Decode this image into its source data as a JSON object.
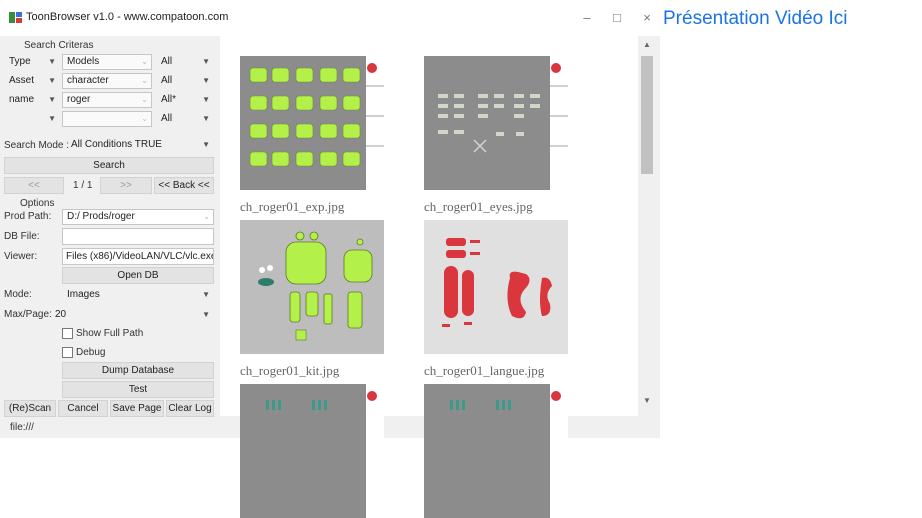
{
  "window": {
    "title": "ToonBrowser v1.0 - www.compatoon.com",
    "minimize": "–",
    "maximize": "□",
    "close": "×"
  },
  "link": {
    "text": "Présentation Vidéo Ici"
  },
  "search": {
    "header": "Search Criteras",
    "rows": [
      {
        "field": "Type",
        "op": "Models",
        "cond": "All"
      },
      {
        "field": "Asset",
        "op": "character",
        "cond": "All"
      },
      {
        "field": "name",
        "op": "roger",
        "cond": "All*"
      },
      {
        "field": "",
        "op": "",
        "cond": "All"
      }
    ],
    "mode_label": "Search Mode :",
    "mode_value": "All Conditions TRUE",
    "search_button": "Search",
    "prev_button": "<<",
    "page": "1 / 1",
    "next_button": ">>",
    "back_button": "<< Back <<"
  },
  "options": {
    "header": "Options",
    "prod_path_label": "Prod Path:",
    "prod_path_value": "D:/ Prods/roger",
    "db_file_label": "DB File:",
    "db_file_value": "",
    "viewer_label": "Viewer:",
    "viewer_value": "Files (x86)/VideoLAN/VLC/vlc.exe",
    "open_db_button": "Open DB",
    "mode_label": "Mode:",
    "mode_value": "Images",
    "max_page_label": "Max/Page:",
    "max_page_value": "20",
    "show_full_path": "Show Full Path",
    "debug": "Debug",
    "dump_button": "Dump Database",
    "test_button": "Test",
    "rescan_button": "(Re)Scan",
    "cancel_button": "Cancel",
    "save_page_button": "Save Page",
    "clear_log_button": "Clear Log"
  },
  "thumbnails": [
    {
      "caption": "ch_roger01_exp.jpg"
    },
    {
      "caption": "ch_roger01_eyes.jpg"
    },
    {
      "caption": "ch_roger01_kit.jpg"
    },
    {
      "caption": "ch_roger01_langue.jpg"
    },
    {
      "caption": ""
    },
    {
      "caption": ""
    }
  ],
  "status": {
    "text": "file:///"
  },
  "colors": {
    "accent_green": "#b4f04a",
    "accent_red": "#d9363e",
    "sheet_gray": "#8c8c8c",
    "link_blue": "#1a73e8"
  }
}
